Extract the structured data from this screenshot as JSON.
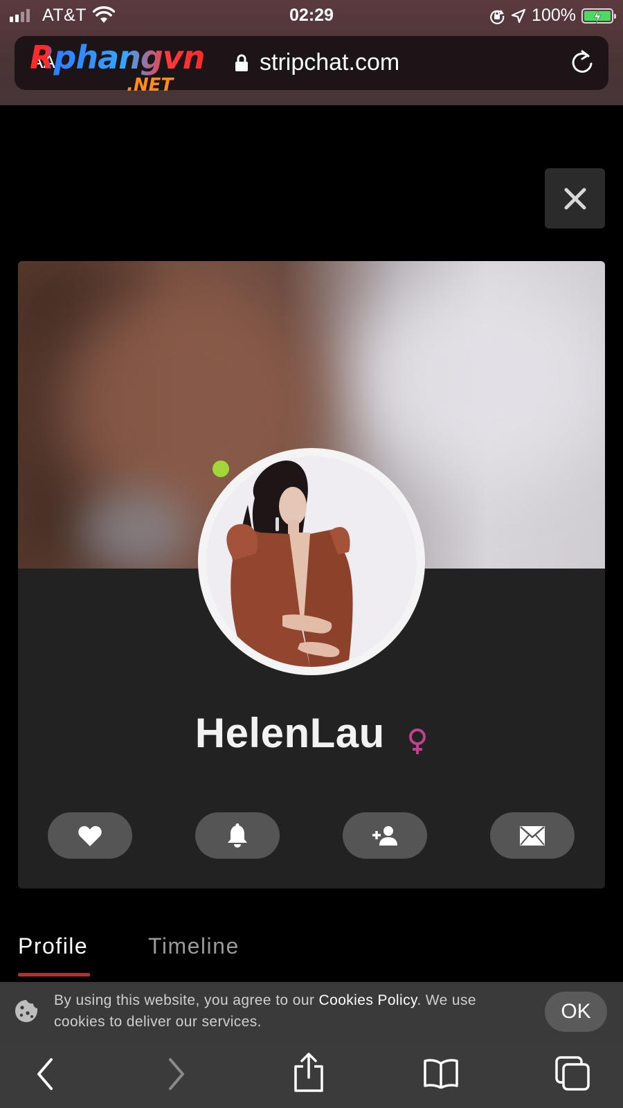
{
  "status_bar": {
    "carrier": "AT&T",
    "time": "02:29",
    "battery": "100%",
    "icons": [
      "signal-icon",
      "wifi-icon",
      "orientation-lock-icon",
      "location-icon",
      "battery-charging-icon"
    ]
  },
  "browser": {
    "aa_label": "AA",
    "watermark_main": "Rphangvn",
    "watermark_sub": ".NET",
    "url": "stripchat.com",
    "icons": [
      "lock-icon",
      "reload-icon"
    ]
  },
  "profile": {
    "username": "HelenLau",
    "gender_symbol": "♀",
    "online": true,
    "online_color": "#a2d63a",
    "gender_color": "#c2418f",
    "actions": [
      "heart-icon",
      "bell-icon",
      "add-friend-icon",
      "envelope-icon"
    ]
  },
  "tabs": [
    {
      "label": "Profile",
      "active": true
    },
    {
      "label": "Timeline",
      "active": false
    }
  ],
  "tab_accent": "#b5302f",
  "cookie": {
    "text_before": "By using this website, you agree to our ",
    "link_text": "Cookies Policy",
    "text_after": ". We use cookies to deliver our services.",
    "ok_label": "OK"
  },
  "toolbar": {
    "icons": [
      "back-icon",
      "forward-icon",
      "share-icon",
      "bookmarks-icon",
      "tabs-icon"
    ]
  }
}
